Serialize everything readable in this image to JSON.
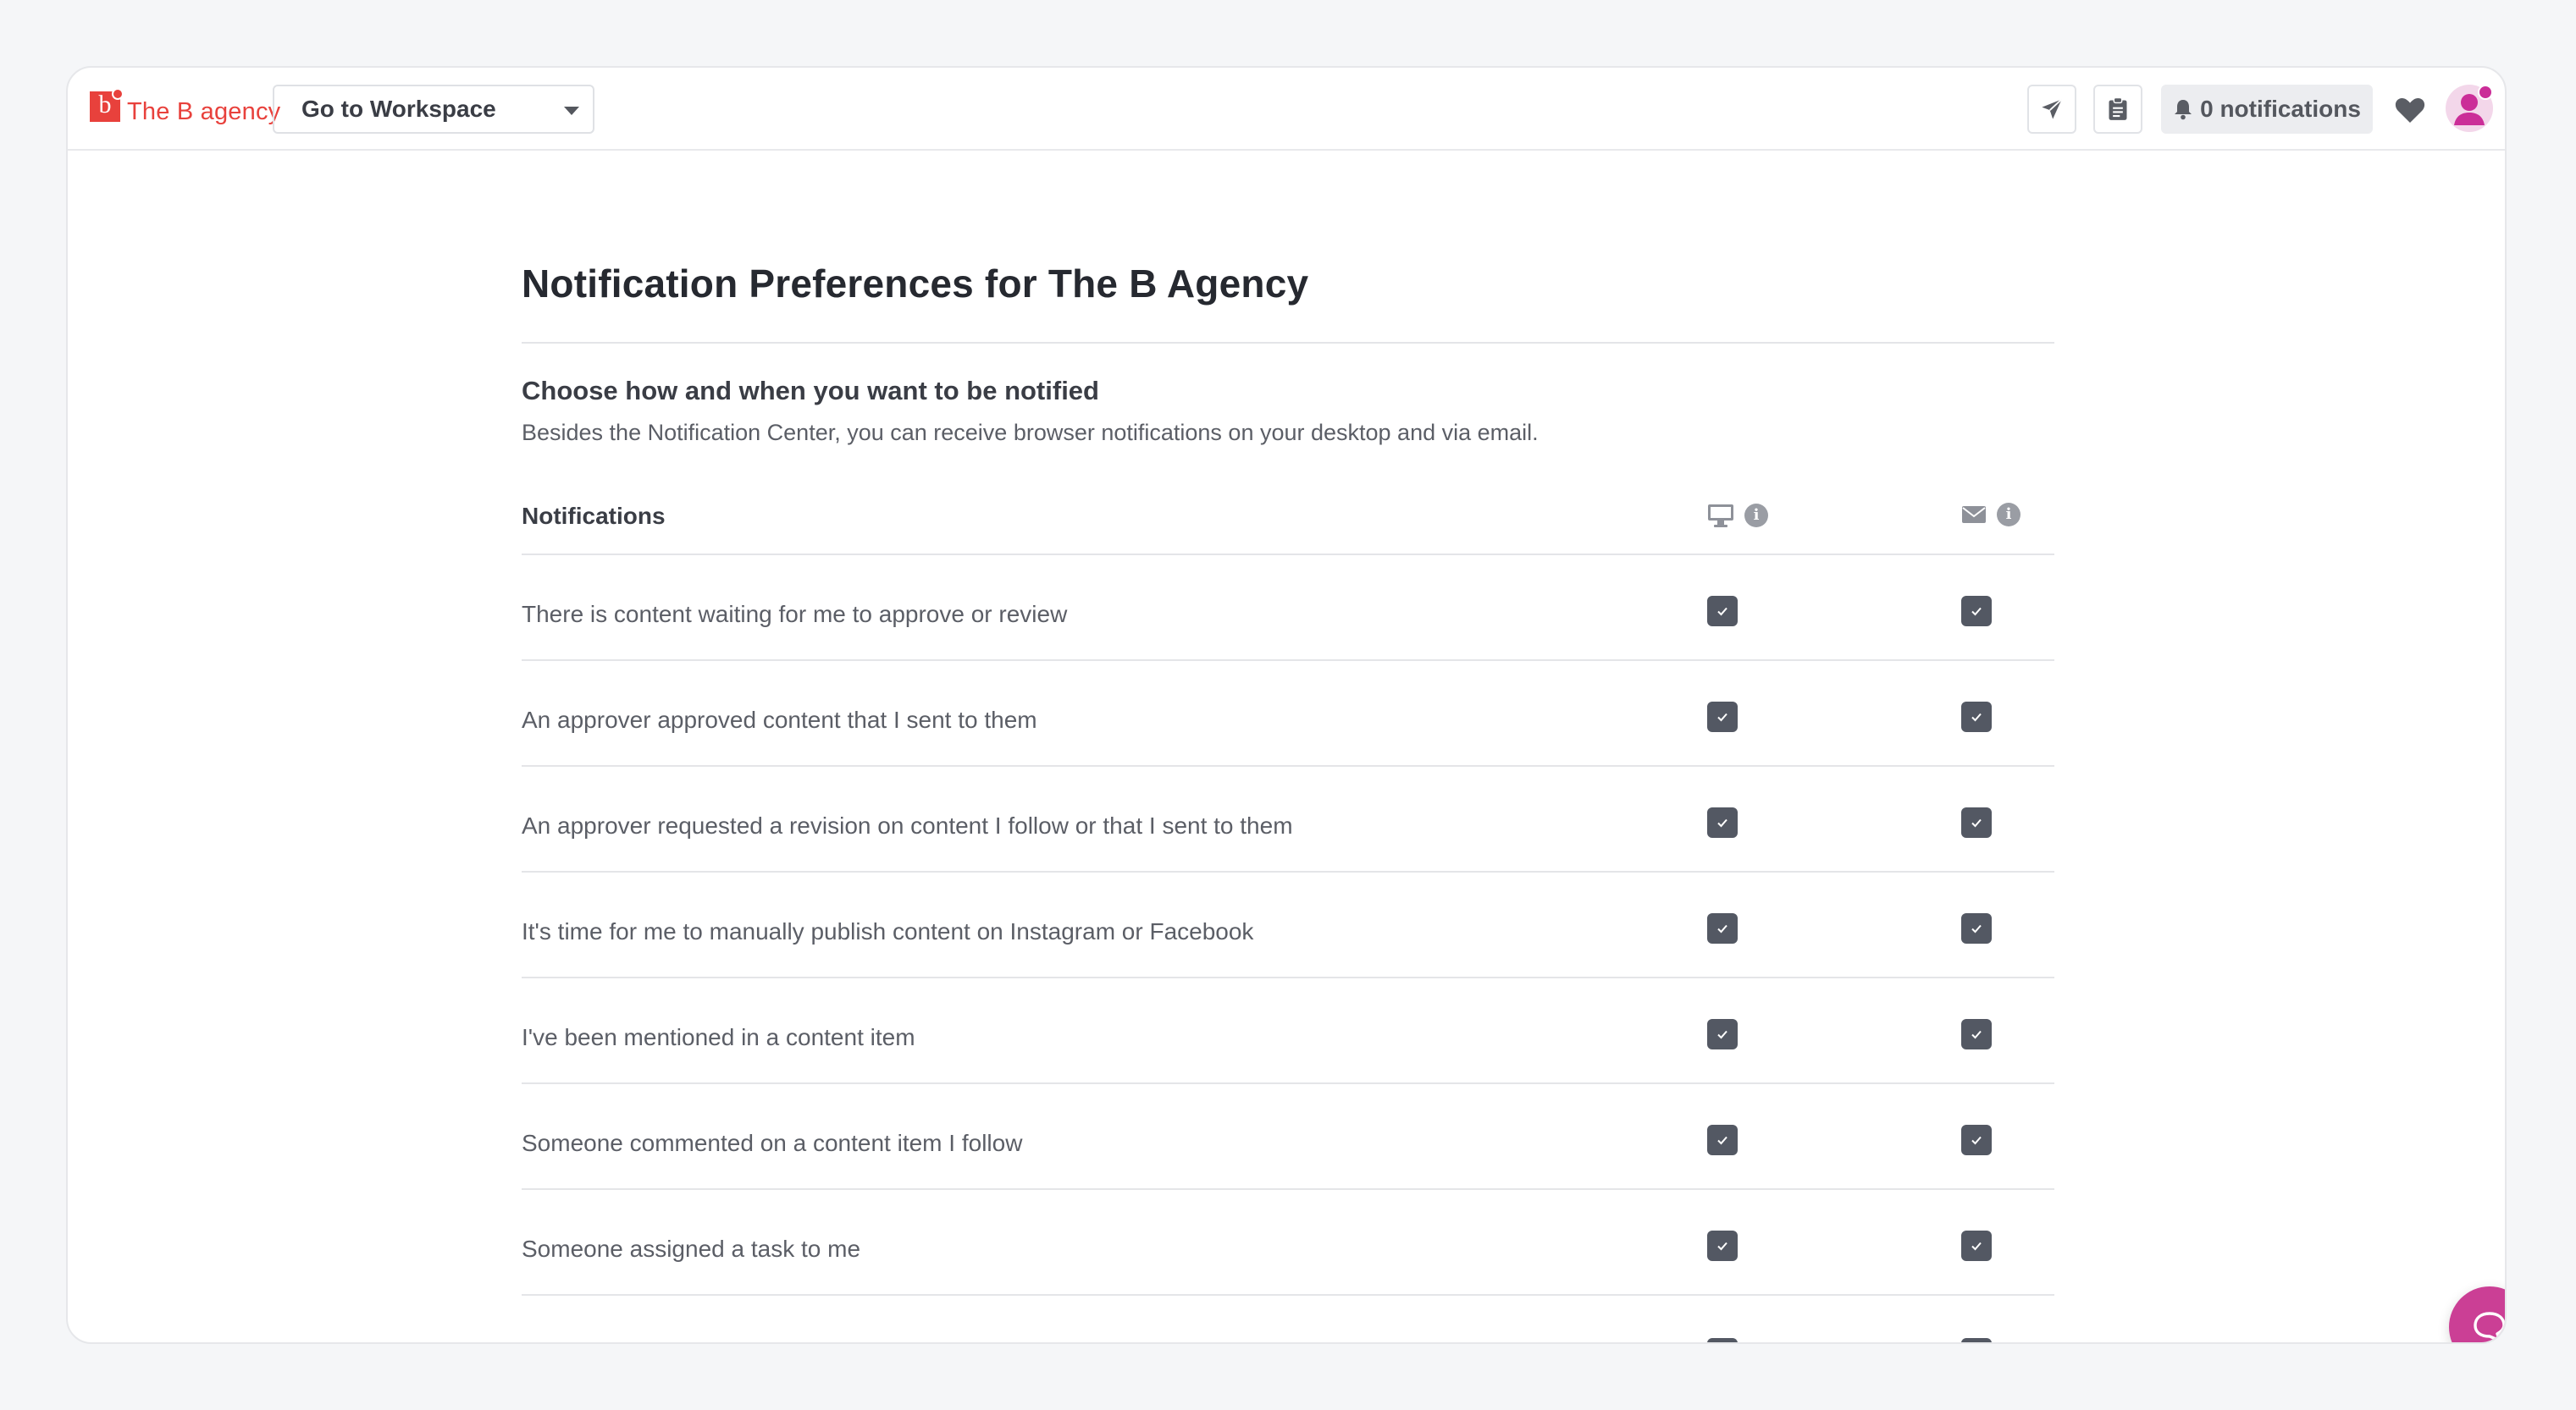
{
  "brand": {
    "logo_letter": "b",
    "name": "The B agency",
    "accent_color": "#e8413c"
  },
  "topbar": {
    "workspace_select": {
      "label": "Go to Workspace",
      "icon": "chevron-down-icon"
    },
    "send_button": {
      "icon": "paper-plane-icon"
    },
    "clipboard_button": {
      "icon": "clipboard-icon"
    },
    "notifications_button": {
      "icon": "bell-icon",
      "label": "0 notifications"
    },
    "favorites_button": {
      "icon": "heart-icon"
    },
    "user_menu": {
      "icon": "user-avatar-icon",
      "indicator_color": "#cb2e98"
    }
  },
  "page": {
    "title": "Notification Preferences for The B Agency",
    "section_heading": "Choose how and when you want to be notified",
    "section_description": "Besides the Notification Center, you can receive browser notifications on your desktop and via email."
  },
  "table": {
    "column_label": "Notifications",
    "columns": [
      {
        "icon": "desktop-icon",
        "info_icon": "info-icon"
      },
      {
        "icon": "envelope-icon",
        "info_icon": "info-icon"
      }
    ],
    "rows": [
      {
        "label": "There is content waiting for me to approve or review",
        "desktop": true,
        "email": true
      },
      {
        "label": "An approver approved content that I sent to them",
        "desktop": true,
        "email": true
      },
      {
        "label": "An approver requested a revision on content I follow or that I sent to them",
        "desktop": true,
        "email": true
      },
      {
        "label": "It's time for me to manually publish content on Instagram or Facebook",
        "desktop": true,
        "email": true
      },
      {
        "label": "I've been mentioned in a content item",
        "desktop": true,
        "email": true
      },
      {
        "label": "Someone commented on a content item I follow",
        "desktop": true,
        "email": true
      },
      {
        "label": "Someone assigned a task to me",
        "desktop": true,
        "email": true
      }
    ]
  },
  "chat_widget": {
    "icon": "chat-bubble-icon",
    "color": "#cb3f95"
  }
}
